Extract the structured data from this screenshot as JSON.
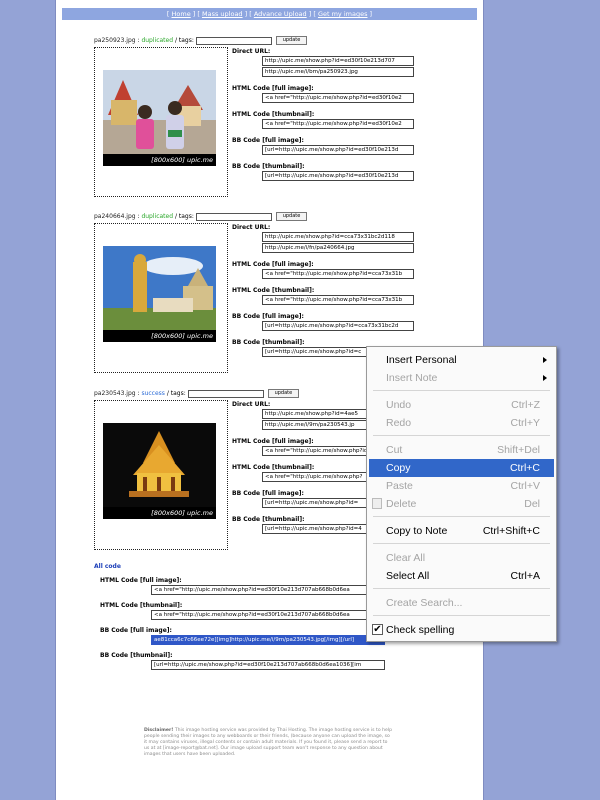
{
  "topnav": {
    "sep_open": "[ ",
    "sep_mid": " ] [ ",
    "sep_close": " ]",
    "links": [
      "Home",
      "Mass upload",
      "Advance Upload",
      "Get my images"
    ]
  },
  "images": [
    {
      "filename": "pa250923.jpg",
      "status": "duplicated",
      "sep1": " : ",
      "sep2": " / tags:",
      "update_label": "update",
      "caption": "[800x600] upic.me",
      "labels": [
        "Direct URL:",
        "HTML Code [full image]:",
        "HTML Code [thumbnail]:",
        "BB Code [full image]:",
        "BB Code [thumbnail]:"
      ],
      "direct": [
        "http://upic.me/show.php?id=ed30f10e213d707",
        "http://upic.me/i/bm/pa250923.jpg"
      ],
      "html_full": "<a href=\"http://upic.me/show.php?id=ed30f10e2",
      "html_thumb": "<a href=\"http://upic.me/show.php?id=ed30f10e2",
      "bb_full": "[url=http://upic.me/show.php?id=ed30f10e213d",
      "bb_thumb": "[url=http://upic.me/show.php?id=ed30f10e213d"
    },
    {
      "filename": "pa240664.jpg",
      "status": "duplicated",
      "sep1": " : ",
      "sep2": " / tags:",
      "update_label": "update",
      "caption": "[800x600] upic.me",
      "labels": [
        "Direct URL:",
        "HTML Code [full image]:",
        "HTML Code [thumbnail]:",
        "BB Code [full image]:",
        "BB Code [thumbnail]:"
      ],
      "direct": [
        "http://upic.me/show.php?id=cca73x31bc2d118",
        "http://upic.me/i/fn/pa240664.jpg"
      ],
      "html_full": "<a href=\"http://upic.me/show.php?id=cca73x31b",
      "html_thumb": "<a href=\"http://upic.me/show.php?id=cca73x31b",
      "bb_full": "[url=http://upic.me/show.php?id=cca73x31bc2d",
      "bb_thumb": "[url=http://upic.me/show.php?id=c"
    },
    {
      "filename": "pa230543.jpg",
      "status": "success",
      "sep1": " : ",
      "sep2": " / tags:",
      "update_label": "update",
      "caption": "[800x600] upic.me",
      "labels": [
        "Direct URL:",
        "HTML Code [full image]:",
        "HTML Code [thumbnail]:",
        "BB Code [full image]:",
        "BB Code [thumbnail]:"
      ],
      "direct": [
        "http://upic.me/show.php?id=4ae5",
        "http://upic.me/i/9m/pa230543.jp"
      ],
      "html_full": "<a href=\"http://upic.me/show.php?id=4",
      "html_thumb": "<a href=\"http://upic.me/show.php?",
      "bb_full": "[url=http://upic.me/show.php?id=",
      "bb_thumb": "[url=http://upic.me/show.php?id=4"
    }
  ],
  "all_code": {
    "title": "All code",
    "html_full_label": "HTML Code [full image]:",
    "html_full": "<a href=\"http://upic.me/show.php?id=ed30f10e213d707ab668b0d6ea",
    "html_thumb_label": "HTML Code [thumbnail]:",
    "html_thumb": "<a href=\"http://upic.me/show.php?id=ed30f10e213d707ab668b0d6ea",
    "bb_full_label": "BB Code [full image]:",
    "bb_full": "ae81cca6c7c66ee72e][img]http://upic.me/i/9m/pa230543.jpg[/img][/url]",
    "bb_thumb_label": "BB Code [thumbnail]:",
    "bb_thumb": "[url=http://upic.me/show.php?id=ed30f10e213d707ab668b0d6ea1036][im"
  },
  "disclaimer": {
    "bold": "Disclaimer!",
    "text": " This image hosting service was provided by Thai Hosting. The image hosting service is to help people sending their images to any webboards or their friends, (because anyone can upload the image, so it may contains viruses, illegal contents or contain adult materials. If you found it, please send a report to us at at [image-report@bat.net]. Our image upload support team won't response to any question about images that users have been uploaded."
  },
  "context_menu": {
    "insert_personal": "Insert Personal",
    "insert_note": "Insert Note",
    "undo": "Undo",
    "undo_sc": "Ctrl+Z",
    "redo": "Redo",
    "redo_sc": "Ctrl+Y",
    "cut": "Cut",
    "cut_sc": "Shift+Del",
    "copy": "Copy",
    "copy_sc": "Ctrl+C",
    "paste": "Paste",
    "paste_sc": "Ctrl+V",
    "delete": "Delete",
    "delete_sc": "Del",
    "copy_to_note": "Copy to Note",
    "copy_to_note_sc": "Ctrl+Shift+C",
    "clear_all": "Clear All",
    "select_all": "Select All",
    "select_all_sc": "Ctrl+A",
    "create_search": "Create Search...",
    "check_spelling": "Check spelling",
    "check_mark": "✔"
  }
}
